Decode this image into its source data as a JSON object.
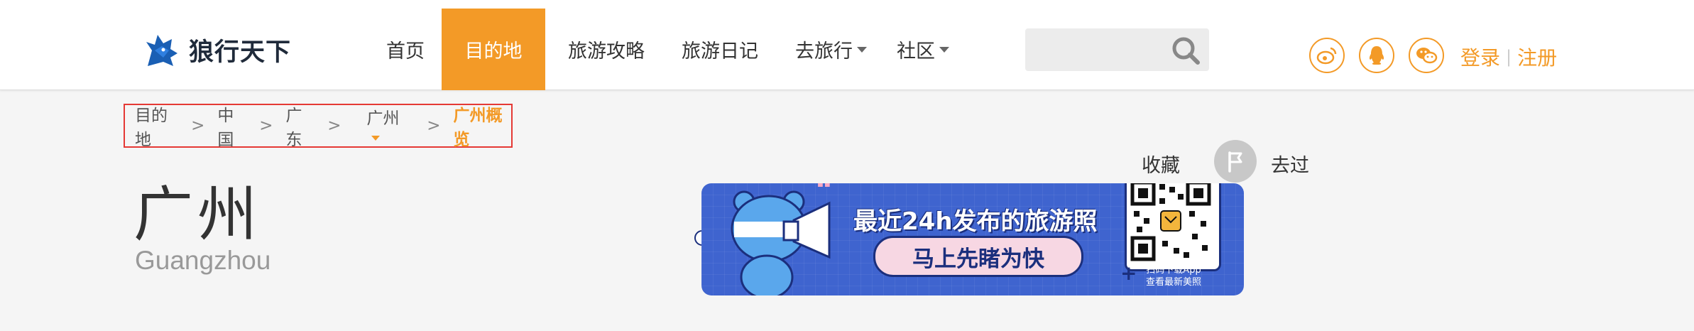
{
  "header": {
    "logo_text": "狼行天下",
    "nav": [
      {
        "label": "首页",
        "active": false,
        "dropdown": false
      },
      {
        "label": "目的地",
        "active": true,
        "dropdown": false
      },
      {
        "label": "旅游攻略",
        "active": false,
        "dropdown": false
      },
      {
        "label": "旅游日记",
        "active": false,
        "dropdown": false
      },
      {
        "label": "去旅行",
        "active": false,
        "dropdown": true
      },
      {
        "label": "社区",
        "active": false,
        "dropdown": true
      }
    ],
    "search": {
      "placeholder": "",
      "icon": "search-icon"
    },
    "social": [
      "weibo-icon",
      "qq-icon",
      "wechat-icon"
    ],
    "login_label": "登录",
    "separator": "|",
    "register_label": "注册"
  },
  "breadcrumb": {
    "items": [
      "目的地",
      "中国",
      "广东",
      "广州"
    ],
    "separator": ">",
    "current": "广州概览"
  },
  "city": {
    "name_cn": "广州",
    "name_en": "Guangzhou"
  },
  "banner": {
    "title": "最近24h发布的旅游照",
    "button": "马上先睹为快",
    "qr_caption_line1": "扫码下载App",
    "qr_caption_line2": "查看最新美照"
  },
  "actions": {
    "collect_label": "收藏",
    "been_label": "去过"
  },
  "colors": {
    "accent": "#f39a27",
    "banner_bg": "#3f64cf",
    "breadcrumb_border": "#e53935"
  }
}
